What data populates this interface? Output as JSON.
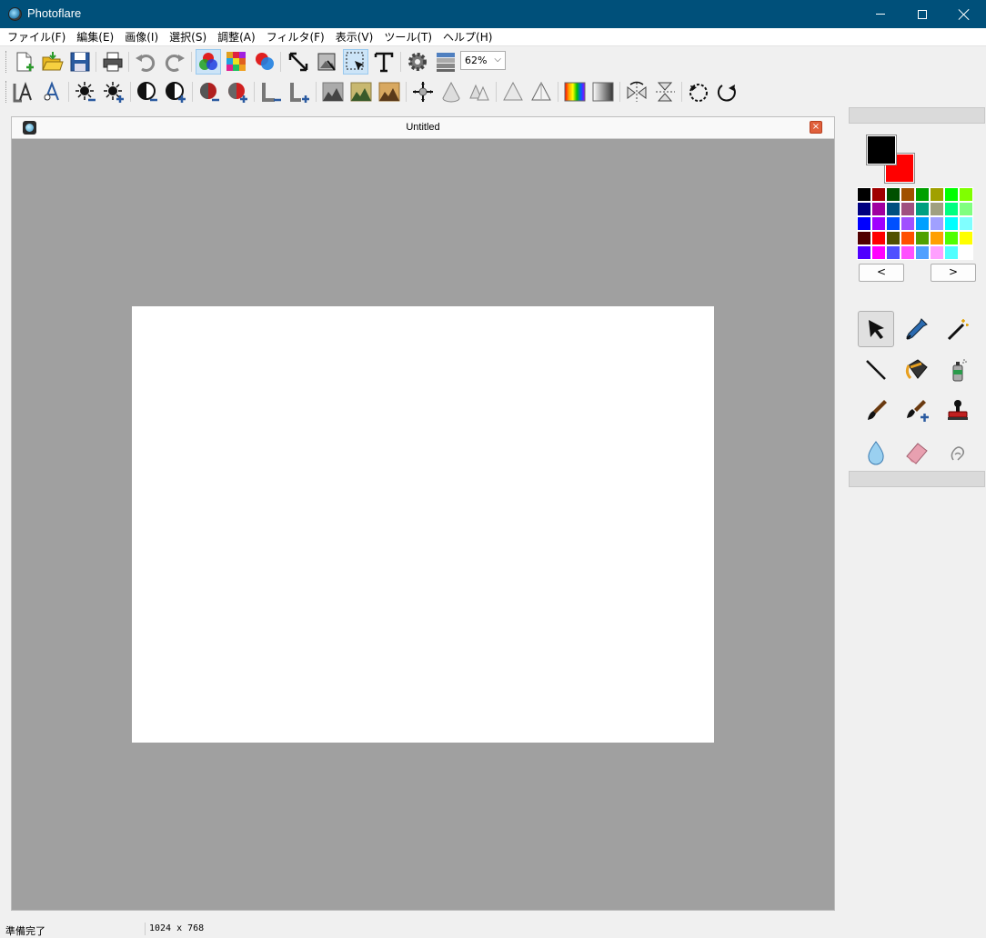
{
  "window": {
    "title": "Photoflare"
  },
  "menu": [
    {
      "label": "ファイル(F)"
    },
    {
      "label": "編集(E)"
    },
    {
      "label": "画像(I)"
    },
    {
      "label": "選択(S)"
    },
    {
      "label": "調整(A)"
    },
    {
      "label": "フィルタ(F)"
    },
    {
      "label": "表示(V)"
    },
    {
      "label": "ツール(T)"
    },
    {
      "label": "ヘルプ(H)"
    }
  ],
  "toolbar": {
    "zoom_value": "62%"
  },
  "document": {
    "title": "Untitled",
    "close_glyph": "×"
  },
  "colors": {
    "foreground": "#000000",
    "background": "#ff0000",
    "palette": [
      "#000000",
      "#a00000",
      "#005000",
      "#a05000",
      "#00a000",
      "#a0a000",
      "#00ff00",
      "#80ff00",
      "#000080",
      "#a000a0",
      "#005080",
      "#a05080",
      "#00a080",
      "#a0a080",
      "#00ff80",
      "#80ff80",
      "#0000ff",
      "#a000ff",
      "#0050ff",
      "#a050ff",
      "#00a0ff",
      "#a0a0ff",
      "#00ffff",
      "#80ffff",
      "#500000",
      "#ff0000",
      "#505000",
      "#ff5000",
      "#50a000",
      "#ffa000",
      "#50ff00",
      "#ffff00",
      "#5000ff",
      "#ff00ff",
      "#5050ff",
      "#ff50ff",
      "#50a0ff",
      "#ffa0ff",
      "#50ffff",
      "#ffffff"
    ],
    "prev_label": "<",
    "next_label": ">"
  },
  "tools": [
    {
      "name": "pointer-tool",
      "icon": "pointer-icon",
      "active": true
    },
    {
      "name": "color-picker-tool",
      "icon": "eyedropper-icon"
    },
    {
      "name": "magic-wand-tool",
      "icon": "magic-wand-icon"
    },
    {
      "name": "line-tool",
      "icon": "line-icon"
    },
    {
      "name": "paint-bucket-tool",
      "icon": "paint-bucket-icon"
    },
    {
      "name": "spray-can-tool",
      "icon": "spray-can-icon"
    },
    {
      "name": "paint-brush-tool",
      "icon": "paint-brush-icon"
    },
    {
      "name": "smart-brush-tool",
      "icon": "smart-brush-icon"
    },
    {
      "name": "clone-stamp-tool",
      "icon": "stamp-icon"
    },
    {
      "name": "blur-tool",
      "icon": "water-drop-icon"
    },
    {
      "name": "eraser-tool",
      "icon": "eraser-icon"
    },
    {
      "name": "smudge-tool",
      "icon": "smudge-icon"
    }
  ],
  "status": {
    "message": "準備完了",
    "dimensions": "1024 x 768"
  }
}
